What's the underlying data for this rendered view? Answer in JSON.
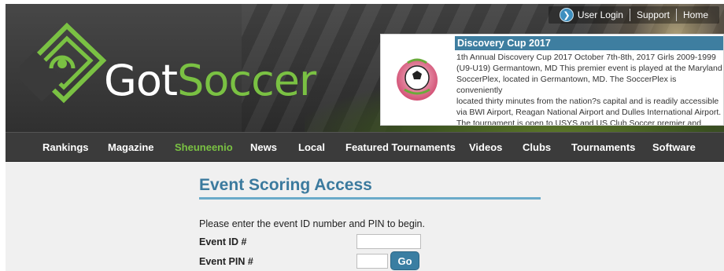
{
  "brand": {
    "name_part1": "Got",
    "name_part2": "Soccer"
  },
  "top_links": {
    "login": "User Login",
    "support": "Support",
    "home": "Home"
  },
  "featured": {
    "title": "Discovery Cup 2017",
    "lines": [
      "1th Annual Discovery Cup 2017 October 7th-8th, 2017 Girls 2009-1999",
      "(U9-U19) Germantown, MD This premier event is played at the Maryland",
      "SoccerPlex, located in Germantown, MD. The SoccerPlex is conveniently",
      "located thirty minutes from the nation?s capital and is readily accessible",
      "via BWI Airport, Reagan National Airport and Dulles International Airport.",
      "The tournament is open to USYS and US Club Soccer premier and travel"
    ]
  },
  "nav": [
    {
      "label": "Rankings",
      "active": false
    },
    {
      "label": "Magazine",
      "active": false
    },
    {
      "label": "Sheuneenio",
      "active": true
    },
    {
      "label": "News",
      "active": false
    },
    {
      "label": "Local",
      "active": false
    },
    {
      "label": "Featured Tournaments",
      "active": false
    },
    {
      "label": "Videos",
      "active": false
    },
    {
      "label": "Clubs",
      "active": false
    },
    {
      "label": "Tournaments",
      "active": false
    },
    {
      "label": "Software",
      "active": false
    }
  ],
  "page": {
    "title": "Event Scoring Access",
    "instructions": "Please enter the event ID number and PIN to begin.",
    "event_id_label": "Event ID #",
    "event_id_value": "",
    "event_pin_label": "Event PIN #",
    "event_pin_value": "",
    "go_label": "Go"
  },
  "colors": {
    "brand_green": "#7ac143",
    "accent_blue": "#3b7a9e",
    "nav_bg": "#3b3b3b"
  }
}
